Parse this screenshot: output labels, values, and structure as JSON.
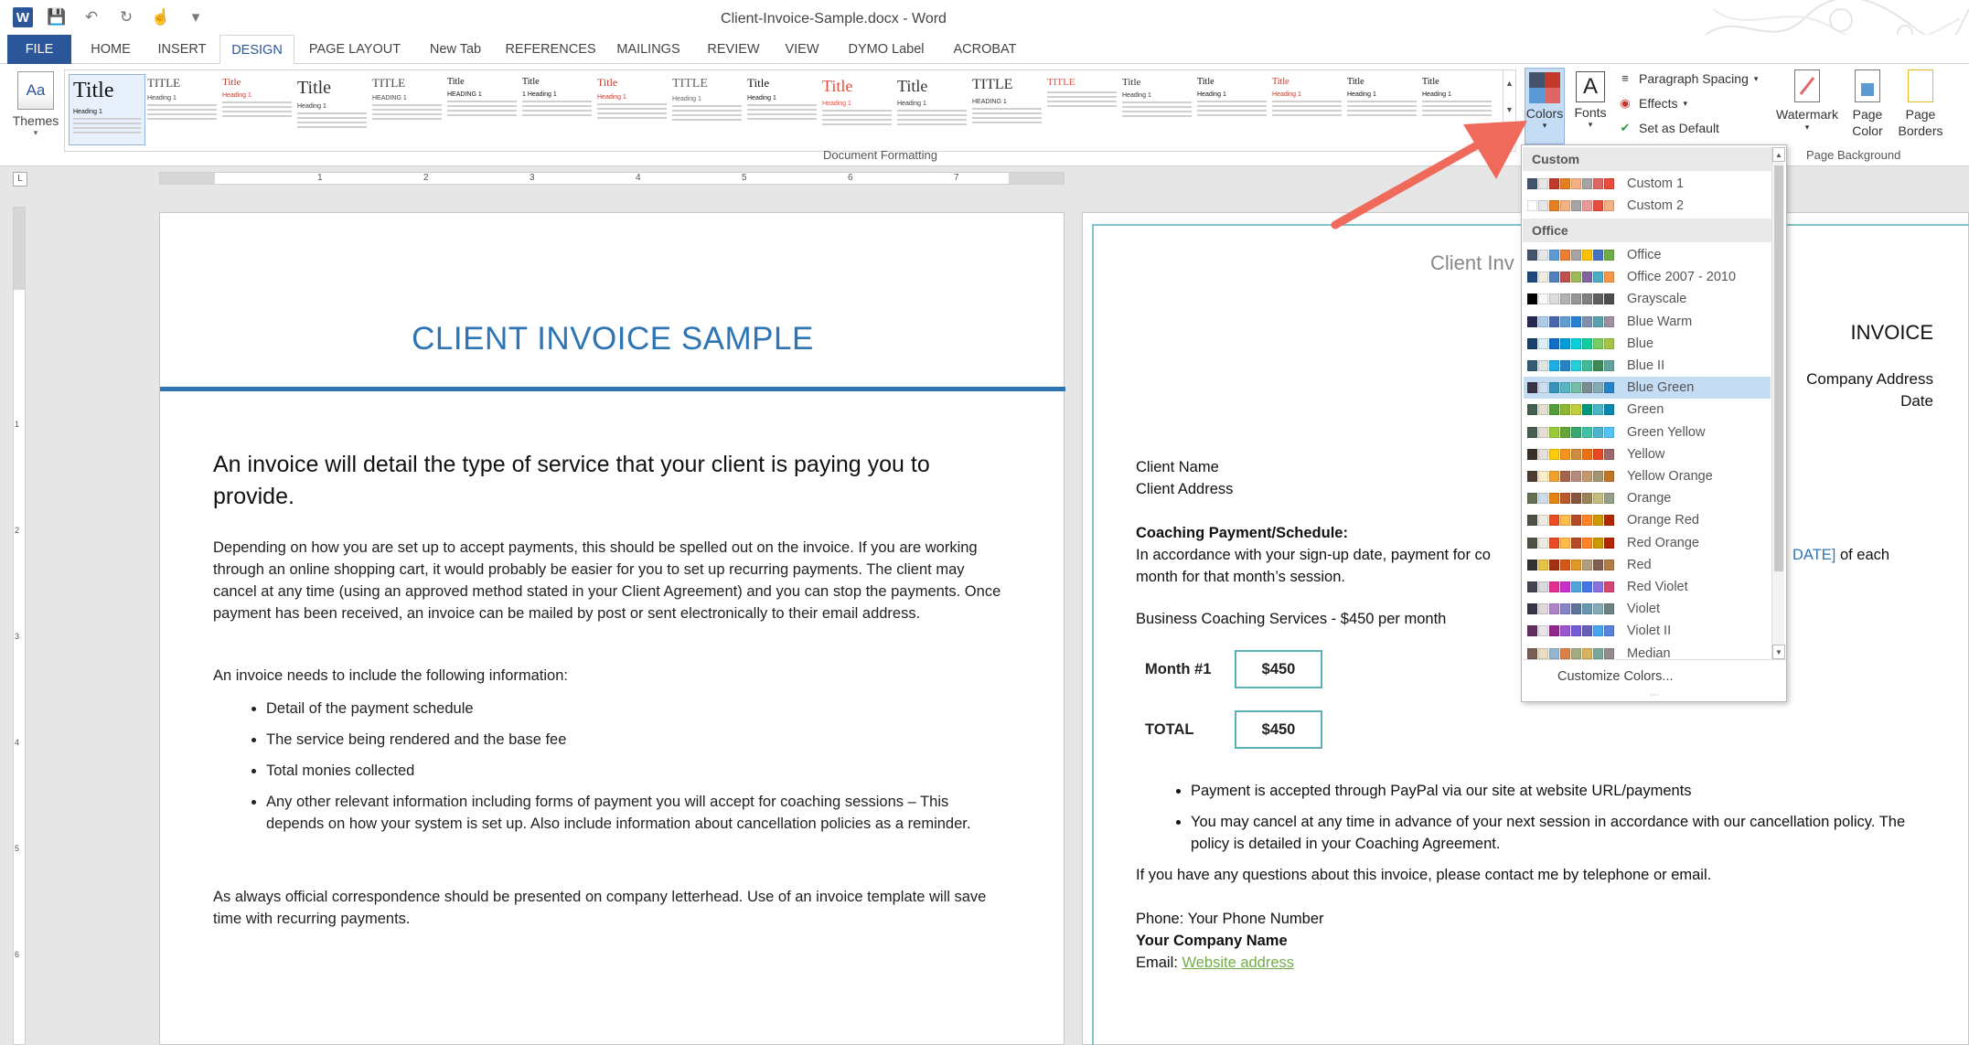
{
  "window": {
    "title": "Client-Invoice-Sample.docx - Word"
  },
  "tabs": [
    "FILE",
    "HOME",
    "INSERT",
    "DESIGN",
    "PAGE LAYOUT",
    "New Tab",
    "REFERENCES",
    "MAILINGS",
    "REVIEW",
    "VIEW",
    "DYMO Label",
    "ACROBAT"
  ],
  "ribbon": {
    "themes_label": "Themes",
    "themes_icon_text": "Aa",
    "group_document_formatting": "Document Formatting",
    "style_tiles": [
      {
        "title": "Title",
        "heading": "Heading 1",
        "color": "#111111"
      },
      {
        "title": "TITLE",
        "heading": "Heading 1",
        "color": "#444444"
      },
      {
        "title": "Title",
        "heading": "Heading 1",
        "color": "#c0392b"
      },
      {
        "title": "Title",
        "heading": "Heading 1",
        "color": "#333333"
      },
      {
        "title": "TITLE",
        "heading": "HEADING 1",
        "color": "#444444"
      },
      {
        "title": "Title",
        "heading": "HEADING 1",
        "color": "#111111"
      },
      {
        "title": "Title",
        "heading": "1 Heading 1",
        "color": "#111111"
      },
      {
        "title": "Title",
        "heading": "Heading 1",
        "color": "#c0392b"
      },
      {
        "title": "TITLE",
        "heading": "Heading 1",
        "color": "#666666"
      },
      {
        "title": "Title",
        "heading": "Heading 1",
        "color": "#111111"
      },
      {
        "title": "Title",
        "heading": "Heading 1",
        "color": "#e74c3c"
      },
      {
        "title": "Title",
        "heading": "Heading 1",
        "color": "#333333"
      },
      {
        "title": "TITLE",
        "heading": "HEADING 1",
        "color": "#333333"
      },
      {
        "title": "TITLE",
        "heading": "",
        "color": "#e74c3c"
      },
      {
        "title": "Title",
        "heading": "Heading 1",
        "color": "#333333"
      },
      {
        "title": "Title",
        "heading": "Heading 1",
        "color": "#111111"
      },
      {
        "title": "Title",
        "heading": "Heading 1",
        "color": "#c0392b"
      },
      {
        "title": "Title",
        "heading": "Heading 1",
        "color": "#111111"
      },
      {
        "title": "Title",
        "heading": "Heading 1",
        "color": "#111111"
      }
    ],
    "colors_label": "Colors",
    "fonts_label": "Fonts",
    "fonts_icon_text": "A",
    "paragraph_spacing_label": "Paragraph Spacing",
    "effects_label": "Effects",
    "set_default_label": "Set as Default",
    "watermark_label": "Watermark",
    "page_color_label": "Page Color",
    "page_color_line1": "Page",
    "page_color_line2": "Color",
    "page_borders_line1": "Page",
    "page_borders_line2": "Borders",
    "group_page_background": "Page Background"
  },
  "ruler": {
    "h_numbers": [
      "1",
      "2",
      "3",
      "4",
      "5",
      "6",
      "7"
    ],
    "v_numbers": [
      "1",
      "2",
      "3",
      "4",
      "5",
      "6"
    ],
    "corner": "L"
  },
  "page1": {
    "title": "CLIENT INVOICE SAMPLE",
    "lead": "An invoice will detail the type of service that your client is paying you to provide.",
    "para1": "Depending on how you are set up to accept payments, this should be spelled out on the invoice. If you are working through an online shopping cart, it would probably be easier for you to set up recurring payments. The client may cancel at any time (using an approved method stated in your Client Agreement) and you can stop the payments. Once payment has been received, an invoice can be mailed by post or sent electronically to their email address.",
    "para2": "An invoice needs to include the following information:",
    "bullets": [
      "Detail of the payment schedule",
      "The service being rendered and the base fee",
      "Total monies collected",
      "Any other relevant information including forms of payment you will accept for coaching sessions – This depends on how your system is set up. Also include information about cancellation policies as a reminder."
    ],
    "para3": "As always official correspondence should be presented on company letterhead. Use of an invoice template will save time with recurring payments."
  },
  "page2": {
    "header": "Client Inv",
    "invoice": "INVOICE",
    "company_address": "Company Address",
    "date": "Date",
    "client_name": "Client Name",
    "client_address": "Client Address",
    "coaching_heading": "Coaching Payment/Schedule:",
    "coaching_line1_start": "In accordance with your sign-up date, payment for co",
    "coaching_line1_end_accent": "DATE]",
    "coaching_line1_end": " of each",
    "coaching_line2": "month for that month’s session.",
    "services": "Business Coaching Services - $450 per month",
    "month_label": "Month #1",
    "month_value": "$450",
    "total_label": "TOTAL",
    "total_value": "$450",
    "bullets": [
      "Payment is accepted through PayPal via our site at website URL/payments",
      "You may cancel at any time in advance of your next session in accordance with our cancellation policy. The policy is detailed in your Coaching Agreement."
    ],
    "questions": "If you have any questions about this invoice, please contact me by telephone or email.",
    "phone": "Phone: Your Phone Number",
    "company_name": "Your Company Name",
    "email_label": "Email: ",
    "email_link": "Website address"
  },
  "colors_dropdown": {
    "section_custom": "Custom",
    "section_office": "Office",
    "custom": [
      {
        "name": "Custom 1",
        "swatches": [
          "#44546a",
          "#e7e6e6",
          "#c0392b",
          "#e67e22",
          "#f4b183",
          "#a5a5a5",
          "#e06666",
          "#e74c3c"
        ]
      },
      {
        "name": "Custom 2",
        "swatches": [
          "#ffffff",
          "#e7e6e6",
          "#e67e22",
          "#f4b183",
          "#a5a5a5",
          "#ea9999",
          "#e74c3c",
          "#f4b183"
        ]
      }
    ],
    "office": [
      {
        "name": "Office",
        "swatches": [
          "#44546a",
          "#e7e6e6",
          "#5b9bd5",
          "#ed7d31",
          "#a5a5a5",
          "#ffc000",
          "#4472c4",
          "#70ad47"
        ]
      },
      {
        "name": "Office 2007 - 2010",
        "swatches": [
          "#1f497d",
          "#eeece1",
          "#4f81bd",
          "#c0504d",
          "#9bbb59",
          "#8064a2",
          "#4bacc6",
          "#f79646"
        ]
      },
      {
        "name": "Grayscale",
        "swatches": [
          "#000000",
          "#f8f8f8",
          "#dddddd",
          "#b2b2b2",
          "#969696",
          "#808080",
          "#5f5f5f",
          "#4d4d4d"
        ]
      },
      {
        "name": "Blue Warm",
        "swatches": [
          "#242852",
          "#acccea",
          "#4a66ac",
          "#629dd1",
          "#297fd5",
          "#7f8fa9",
          "#5aa2ae",
          "#9d90a0"
        ]
      },
      {
        "name": "Blue",
        "swatches": [
          "#17406d",
          "#dbeff9",
          "#0f6fc6",
          "#009dd9",
          "#0bd0d9",
          "#10cf9b",
          "#7cca62",
          "#a5c249"
        ]
      },
      {
        "name": "Blue II",
        "swatches": [
          "#335b74",
          "#dfe3e5",
          "#1cade4",
          "#2683c6",
          "#27ced7",
          "#42ba97",
          "#3e8853",
          "#62a39f"
        ]
      },
      {
        "name": "Blue Green",
        "swatches": [
          "#373545",
          "#ceddf0",
          "#3494ba",
          "#58b6c0",
          "#75bda7",
          "#7a8c8e",
          "#84acb6",
          "#2683c6"
        ]
      },
      {
        "name": "Green",
        "swatches": [
          "#455f51",
          "#e3ded1",
          "#549e39",
          "#8ab833",
          "#c0cf3a",
          "#029676",
          "#4ab5c4",
          "#0989b1"
        ]
      },
      {
        "name": "Green Yellow",
        "swatches": [
          "#455f51",
          "#e3ded1",
          "#99cb38",
          "#63a537",
          "#37a76f",
          "#44c1a3",
          "#4eb3cf",
          "#51c3f9"
        ]
      },
      {
        "name": "Yellow",
        "swatches": [
          "#39302a",
          "#e5dedb",
          "#ffca08",
          "#f8931d",
          "#ce8d3e",
          "#ec7016",
          "#e64823",
          "#9c6a6a"
        ]
      },
      {
        "name": "Yellow Orange",
        "swatches": [
          "#4e3b30",
          "#fbeec9",
          "#f0a22e",
          "#a5644e",
          "#b58b80",
          "#c3986d",
          "#a19574",
          "#c17529"
        ]
      },
      {
        "name": "Orange",
        "swatches": [
          "#637052",
          "#ccddea",
          "#e48312",
          "#bd582c",
          "#865640",
          "#9b8357",
          "#c2bc80",
          "#94a088"
        ]
      },
      {
        "name": "Orange Red",
        "swatches": [
          "#505046",
          "#eeece1",
          "#e84c22",
          "#ffbd47",
          "#b64926",
          "#ff8427",
          "#cc9900",
          "#b22600"
        ]
      },
      {
        "name": "Red Orange",
        "swatches": [
          "#505046",
          "#eeece1",
          "#e84c22",
          "#ffbd47",
          "#b64926",
          "#ff8427",
          "#cc9900",
          "#b22600"
        ]
      },
      {
        "name": "Red",
        "swatches": [
          "#323232",
          "#e5c243",
          "#a5300f",
          "#d55816",
          "#e19825",
          "#b19c7d",
          "#7f5f52",
          "#b27d49"
        ]
      },
      {
        "name": "Red Violet",
        "swatches": [
          "#454551",
          "#d8d9dc",
          "#e32d91",
          "#c830cc",
          "#4ea6dc",
          "#4775e7",
          "#8971e1",
          "#d54773"
        ]
      },
      {
        "name": "Violet",
        "swatches": [
          "#373545",
          "#dcd8dc",
          "#ad84c6",
          "#8784c7",
          "#5d739a",
          "#6997af",
          "#84acb6",
          "#6f8183"
        ]
      },
      {
        "name": "Violet II",
        "swatches": [
          "#632e62",
          "#eae5eb",
          "#92278f",
          "#9b57d3",
          "#755dd9",
          "#665eb8",
          "#45a5ed",
          "#5982db"
        ]
      },
      {
        "name": "Median",
        "swatches": [
          "#775f55",
          "#ebddc3",
          "#94b6d2",
          "#dd8047",
          "#a5ab81",
          "#d8b25c",
          "#7ba79d",
          "#968c8c"
        ]
      }
    ],
    "selected": "Blue Green",
    "customize_label": "Customize Colors..."
  },
  "colors_icon": [
    "#44546a",
    "#c0392b",
    "#5b9bd5",
    "#e06666"
  ]
}
